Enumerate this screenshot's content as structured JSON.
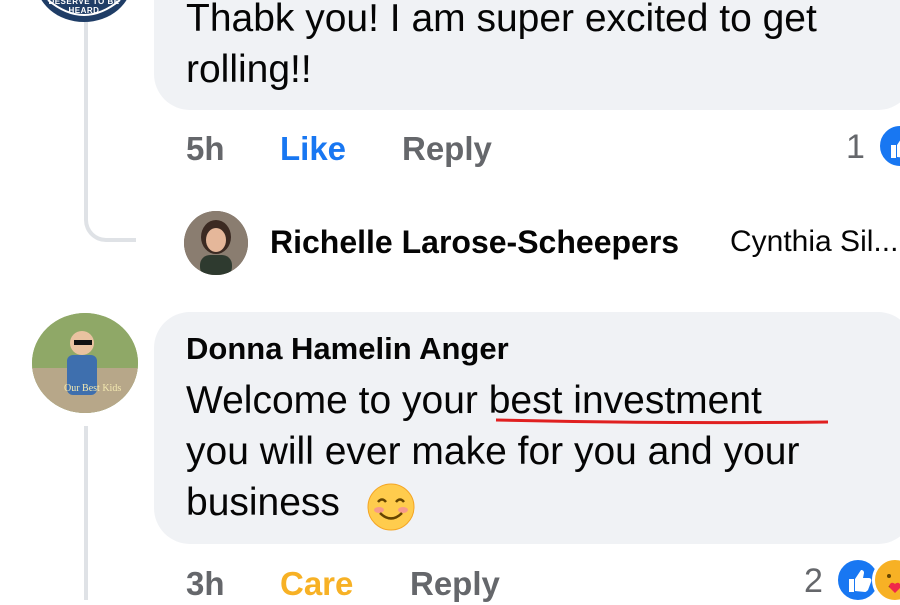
{
  "comment_1": {
    "text_line1": "Thabk you!  I am super excited to get",
    "text_line2": "rolling!!",
    "avatar_text": "DESERVE TO BE HEARD",
    "time": "5h",
    "reaction_label": "Like",
    "reply_label": "Reply",
    "reaction_count": "1"
  },
  "reply_preview": {
    "author": "Richelle Larose-Scheepers",
    "snippet": "Cynthia Sil..."
  },
  "comment_2": {
    "author": "Donna Hamelin Anger",
    "text_line1": "Welcome to your best investment",
    "text_line2": "you will ever make for you and your",
    "text_line3": "business",
    "avatar_watermark": "Our Best Kids",
    "time": "3h",
    "reaction_label": "Care",
    "reply_label": "Reply",
    "reaction_count": "2"
  },
  "colors": {
    "like_blue": "#1877f2",
    "care_yellow": "#f7b125",
    "meta_gray": "#65676b",
    "bubble_bg": "#f0f2f5",
    "underline_red": "#e02020"
  },
  "icons": [
    "like-reaction-icon",
    "care-reaction-icon",
    "smiling-face-emoji-icon"
  ]
}
